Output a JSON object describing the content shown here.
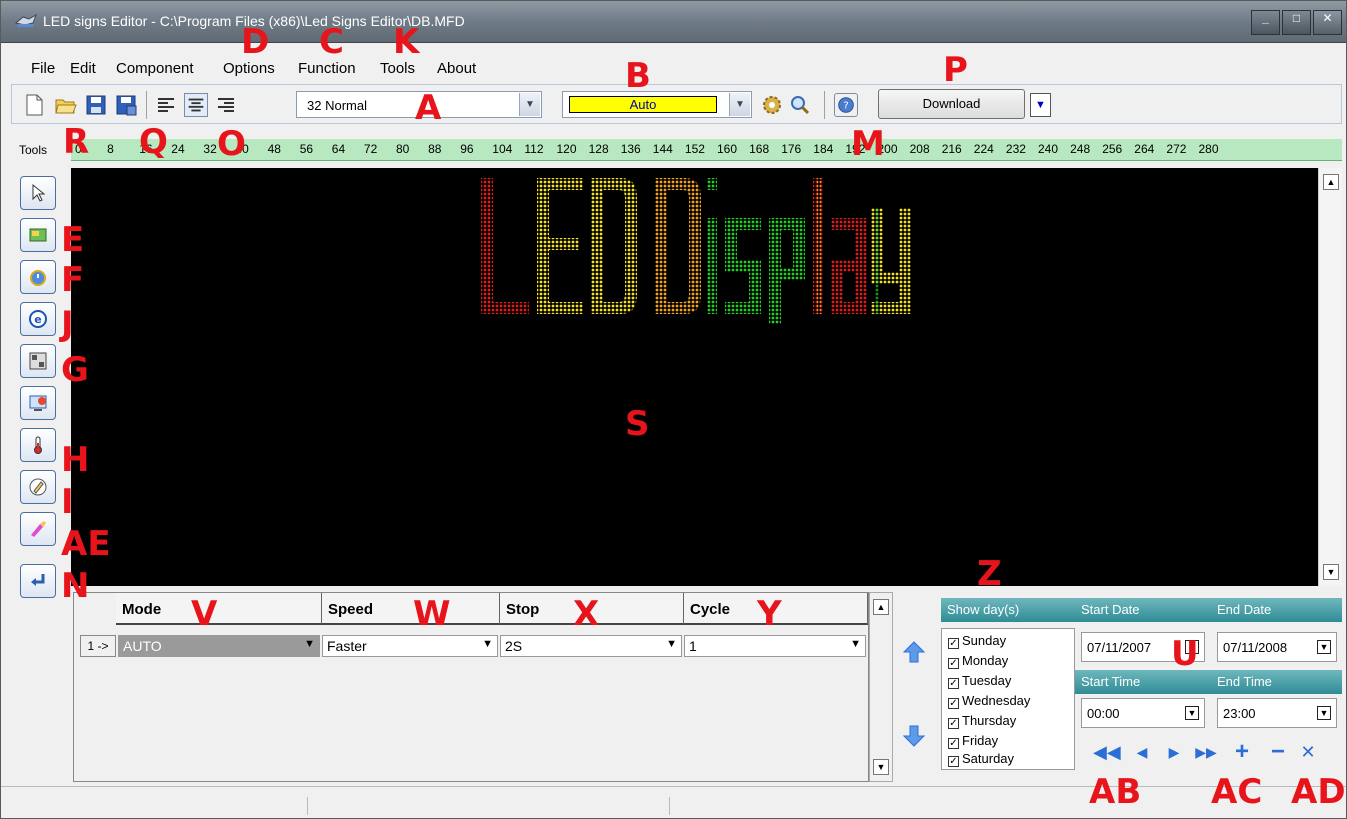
{
  "window": {
    "title": "LED signs Editor - C:\\Program Files (x86)\\Led Signs Editor\\DB.MFD",
    "buttons": [
      "_",
      "□",
      "✕"
    ]
  },
  "menu": [
    "File",
    "Edit",
    "Component",
    "Options",
    "Function",
    "Tools",
    "About"
  ],
  "toolbar": {
    "font_combo": "32 Normal",
    "color_combo": "Auto",
    "download_label": "Download"
  },
  "ruler": {
    "label": "Tools",
    "ticks": [
      "0",
      "8",
      "16",
      "24",
      "32",
      "40",
      "48",
      "56",
      "64",
      "72",
      "80",
      "88",
      "96",
      "104",
      "112",
      "120",
      "128",
      "136",
      "144",
      "152",
      "160",
      "168",
      "176",
      "184",
      "192",
      "200",
      "208",
      "216",
      "224",
      "232",
      "240",
      "248",
      "256",
      "264",
      "272",
      "280"
    ]
  },
  "display": {
    "text": "LED Display",
    "colors": [
      "#e01b1b",
      "#f5e21a",
      "#f5a21a",
      "#22d022"
    ]
  },
  "grid": {
    "columns": [
      "Mode",
      "Speed",
      "Stop",
      "Cycle"
    ],
    "rows": [
      {
        "header": "1 ->",
        "mode": "AUTO",
        "speed": "Faster",
        "stop": "2S",
        "cycle": "1"
      }
    ]
  },
  "schedule": {
    "show_days_label": "Show day(s)",
    "start_date_label": "Start Date",
    "end_date_label": "End Date",
    "start_time_label": "Start Time",
    "end_time_label": "End Time",
    "days": [
      "Sunday",
      "Monday",
      "Tuesday",
      "Wednesday",
      "Thursday",
      "Friday",
      "Saturday"
    ],
    "start_date": "07/11/2007",
    "end_date": "07/11/2008",
    "start_time": "00:00",
    "end_time": "23:00"
  },
  "annotations": {
    "A": "A",
    "B": "B",
    "C": "C",
    "D": "D",
    "E": "E",
    "F": "F",
    "G": "G",
    "H": "H",
    "I": "I",
    "J": "J",
    "K": "K",
    "M": "M",
    "N": "N",
    "O": "O",
    "P": "P",
    "Q": "Q",
    "R": "R",
    "S": "S",
    "U": "U",
    "V": "V",
    "W": "W",
    "X": "X",
    "Y": "Y",
    "Z": "Z",
    "AB": "AB",
    "AC": "AC",
    "AD": "AD",
    "AE": "AE"
  }
}
